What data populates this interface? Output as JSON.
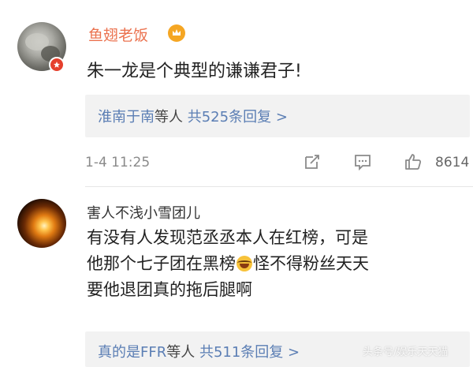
{
  "comment1": {
    "username": "鱼翅老饭",
    "text": "朱一龙是个典型的谦谦君子!",
    "reply_summary": {
      "names": "淮南于南",
      "connector": "等人",
      "count_text": "共525条回复",
      "arrow": ">"
    },
    "time": "1-4 11:25",
    "like_count": "8614",
    "icons": {
      "vip": "vip-badge-icon",
      "crown": "crown-badge-icon",
      "repost": "repost-icon",
      "comment": "comment-icon",
      "like": "like-icon"
    }
  },
  "comment2": {
    "username": "害人不浅小雪团儿",
    "text_lines": [
      "有没有人发现范丞丞本人在红榜，可是",
      "他那个七子团在黑榜",
      "怪不得粉丝天天",
      "要他退团真的拖后腿啊"
    ],
    "emoji": "laughing-tears-emoji",
    "reply_summary": {
      "names": "真的是FFR",
      "connector": "等人",
      "count_text": "共511条回复",
      "arrow": ">"
    }
  },
  "watermark": "头条号/娱乐天天猫",
  "colors": {
    "username_vip": "#eb7350",
    "link_blue": "#5b7eb4",
    "reply_bg": "#f2f2f2",
    "muted": "#8a8a8a"
  }
}
